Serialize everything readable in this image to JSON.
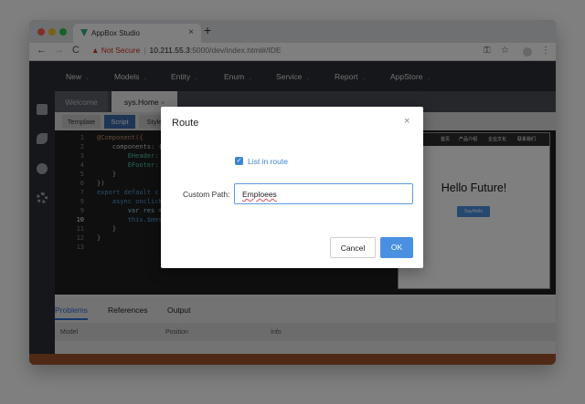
{
  "browser": {
    "tab_title": "AppBox Studio",
    "tab_close": "×",
    "new_tab": "+",
    "nav_back": "←",
    "nav_forward": "→",
    "nav_reload": "C",
    "security_label": "Not Secure",
    "url_host": "10.211.55.3",
    "url_path": ":5000/dev/index.html#/IDE",
    "key_icon": "⚿",
    "star_icon": "☆",
    "menu_icon": "⋮"
  },
  "menu": {
    "items": [
      "New",
      "Models",
      "Entity",
      "Enum",
      "Service",
      "Report",
      "AppStore"
    ]
  },
  "doc_tabs": [
    {
      "label": "Welcome"
    },
    {
      "label": "sys.Home",
      "close": "×"
    }
  ],
  "sub_tabs": [
    "Template",
    "Script",
    "Style"
  ],
  "code": {
    "lines": [
      {
        "n": "1",
        "text": "@Component({"
      },
      {
        "n": "2",
        "text": "    components: {"
      },
      {
        "n": "3",
        "text": "        EHeader:"
      },
      {
        "n": "4",
        "text": "        EFooter:"
      },
      {
        "n": "5",
        "text": "    }"
      },
      {
        "n": "6",
        "text": "})"
      },
      {
        "n": "7",
        "text": "export default c"
      },
      {
        "n": "9",
        "text": "    async onclick"
      },
      {
        "n": "9",
        "text": "        var res ="
      },
      {
        "n": "10",
        "text": "        this.$mes"
      },
      {
        "n": "11",
        "text": "    }"
      },
      {
        "n": "12",
        "text": "}"
      },
      {
        "n": "13",
        "text": ""
      }
    ]
  },
  "preview": {
    "nav_items": [
      "首页",
      "产品介绍",
      "企业文化",
      "联系我们"
    ],
    "hello_text": "Hello Future!",
    "button_label": "SayHello"
  },
  "bottom_panel": {
    "tabs": [
      "Problems",
      "References",
      "Output"
    ],
    "columns": [
      "Model",
      "Position",
      "Info"
    ]
  },
  "dialog": {
    "title": "Route",
    "close": "×",
    "checkbox_label": "List in route",
    "checkbox_checked": true,
    "checkmark": "✓",
    "field_label": "Custom Path:",
    "field_value": "Emploees",
    "cancel_label": "Cancel",
    "ok_label": "OK"
  },
  "colors": {
    "accent": "#4a90e2",
    "check": "#3a86d1",
    "status_bar": "#a0522d",
    "warning": "#d93025"
  }
}
